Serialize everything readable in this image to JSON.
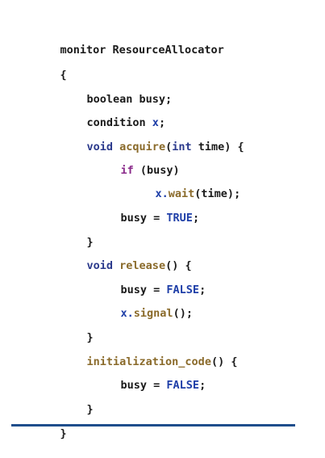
{
  "code": {
    "l01": {
      "t1": "monitor ResourceAllocator"
    },
    "l02": {
      "t1": "{"
    },
    "l03": {
      "t1": "boolean busy;"
    },
    "l04": {
      "t1": "condition ",
      "t2": "x",
      "t3": ";"
    },
    "l05": {
      "t1": "void",
      "t2": " ",
      "t3": "acquire",
      "t4": "(",
      "t5": "int",
      "t6": " time) {"
    },
    "l06": {
      "t1": "if",
      "t2": " (busy)"
    },
    "l07": {
      "t1": "x.",
      "t2": "wait",
      "t3": "(time);"
    },
    "l08": {
      "t1": "busy = ",
      "t2": "TRUE",
      "t3": ";"
    },
    "l09": {
      "t1": "}"
    },
    "l10": {
      "t1": "void",
      "t2": " ",
      "t3": "release",
      "t4": "() {"
    },
    "l11": {
      "t1": "busy = ",
      "t2": "FALSE",
      "t3": ";"
    },
    "l12": {
      "t1": "x.",
      "t2": "signal",
      "t3": "();"
    },
    "l13": {
      "t1": "}"
    },
    "l14": {
      "t1": "initialization_code",
      "t2": "() {"
    },
    "l15": {
      "t1": "busy = ",
      "t2": "FALSE",
      "t3": ";"
    },
    "l16": {
      "t1": "}"
    },
    "l17": {
      "t1": "}"
    }
  },
  "colors": {
    "text": "#1a1a1a",
    "keyword_blue": "#2b3a8c",
    "keyword_purple": "#8a2a8a",
    "function": "#8a6a2a",
    "constant": "#1f3fa8",
    "rule": "#1f4e8c"
  }
}
